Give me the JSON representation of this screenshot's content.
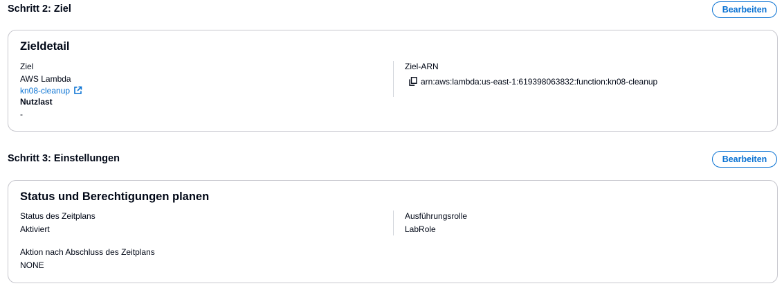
{
  "step2": {
    "header": "Schritt 2: Ziel",
    "edit_label": "Bearbeiten",
    "card": {
      "title": "Zieldetail",
      "target_label": "Ziel",
      "target_service": "AWS Lambda",
      "target_function_link": "kn08-cleanup",
      "payload_label": "Nutzlast",
      "payload_value": "-",
      "arn_label": "Ziel-ARN",
      "arn_value": "arn:aws:lambda:us-east-1:619398063832:function:kn08-cleanup"
    }
  },
  "step3": {
    "header": "Schritt 3: Einstellungen",
    "edit_label": "Bearbeiten",
    "card": {
      "title": "Status und Berechtigungen planen",
      "schedule_status_label": "Status des Zeitplans",
      "schedule_status_value": "Aktiviert",
      "execution_role_label": "Ausführungsrolle",
      "execution_role_value": "LabRole",
      "after_completion_label": "Aktion nach Abschluss des Zeitplans",
      "after_completion_value": "NONE"
    }
  },
  "icons": {
    "external_link": "external-link-icon",
    "copy": "copy-icon"
  },
  "colors": {
    "link": "#0972d3",
    "text": "#000716",
    "border": "#c6c6cd"
  }
}
